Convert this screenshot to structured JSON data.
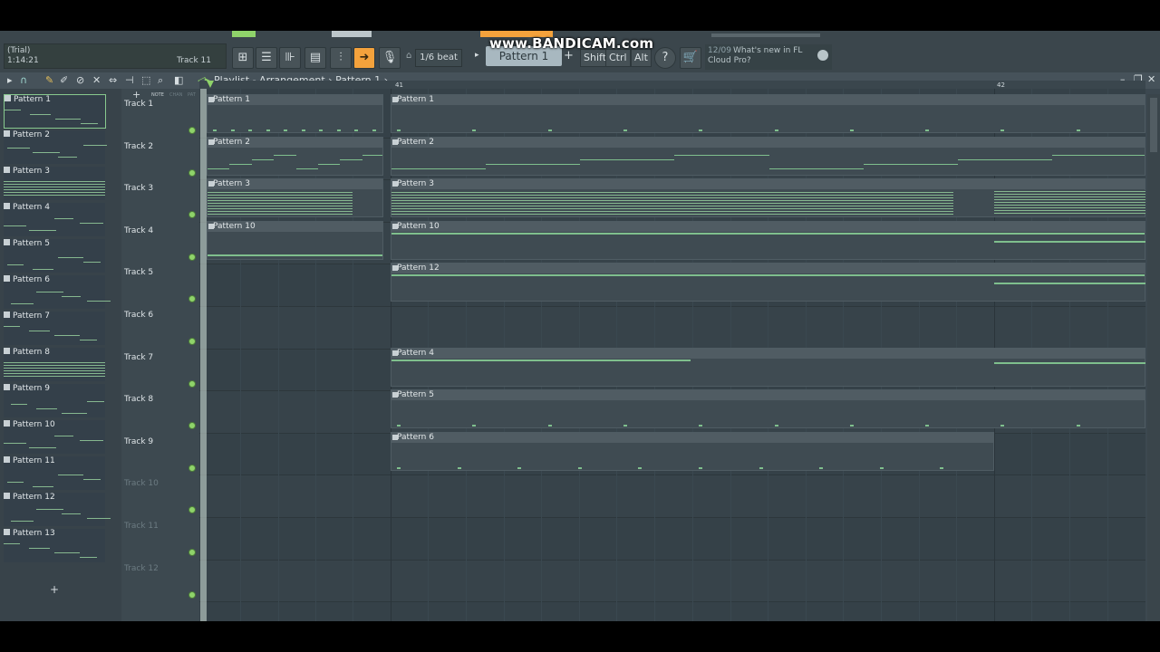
{
  "watermark": "www.BANDICAM.com",
  "toolbar": {
    "trial": "(Trial)",
    "time": "1:14:21",
    "hint_track": "Track 11",
    "snap": "1/6 beat",
    "pattern_selected": "Pattern 1",
    "add": "+",
    "modifiers": [
      "Shift",
      "Ctrl",
      "Alt"
    ],
    "news_date": "12/09",
    "news_text": "What's new in FL",
    "news_text2": "Cloud Pro?"
  },
  "playlist": {
    "title": "Playlist - Arrangement",
    "pattern": "Pattern 1",
    "ruler_labels": [
      "41",
      "42"
    ],
    "picker_header_labels": [
      "NOTE",
      "CHAN",
      "PAT"
    ],
    "add_pattern": "+"
  },
  "patterns": [
    "Pattern 1",
    "Pattern 2",
    "Pattern 3",
    "Pattern 4",
    "Pattern 5",
    "Pattern 6",
    "Pattern 7",
    "Pattern 8",
    "Pattern 9",
    "Pattern 10",
    "Pattern 11",
    "Pattern 12",
    "Pattern 13"
  ],
  "tracks": [
    {
      "name": "Track 1",
      "active": true
    },
    {
      "name": "Track 2",
      "active": true
    },
    {
      "name": "Track 3",
      "active": true
    },
    {
      "name": "Track 4",
      "active": true
    },
    {
      "name": "Track 5",
      "active": true
    },
    {
      "name": "Track 6",
      "active": true
    },
    {
      "name": "Track 7",
      "active": true
    },
    {
      "name": "Track 8",
      "active": true
    },
    {
      "name": "Track 9",
      "active": true
    },
    {
      "name": "Track 10",
      "active": false
    },
    {
      "name": "Track 11",
      "active": false
    },
    {
      "name": "Track 12",
      "active": false
    }
  ],
  "clips": [
    {
      "label": "Pattern 1",
      "track": 0,
      "seg": "a"
    },
    {
      "label": "Pattern 1",
      "track": 0,
      "seg": "b"
    },
    {
      "label": "Pattern 2",
      "track": 1,
      "seg": "a"
    },
    {
      "label": "Pattern 2",
      "track": 1,
      "seg": "b"
    },
    {
      "label": "Pattern 3",
      "track": 2,
      "seg": "a"
    },
    {
      "label": "Pattern 3",
      "track": 2,
      "seg": "b"
    },
    {
      "label": "Pattern 10",
      "track": 3,
      "seg": "a"
    },
    {
      "label": "Pattern 10",
      "track": 3,
      "seg": "b"
    },
    {
      "label": "Pattern 12",
      "track": 4,
      "seg": "b"
    },
    {
      "label": "Pattern 4",
      "track": 6,
      "seg": "b"
    },
    {
      "label": "Pattern 5",
      "track": 7,
      "seg": "b"
    },
    {
      "label": "Pattern 6",
      "track": 8,
      "seg": "c"
    }
  ]
}
